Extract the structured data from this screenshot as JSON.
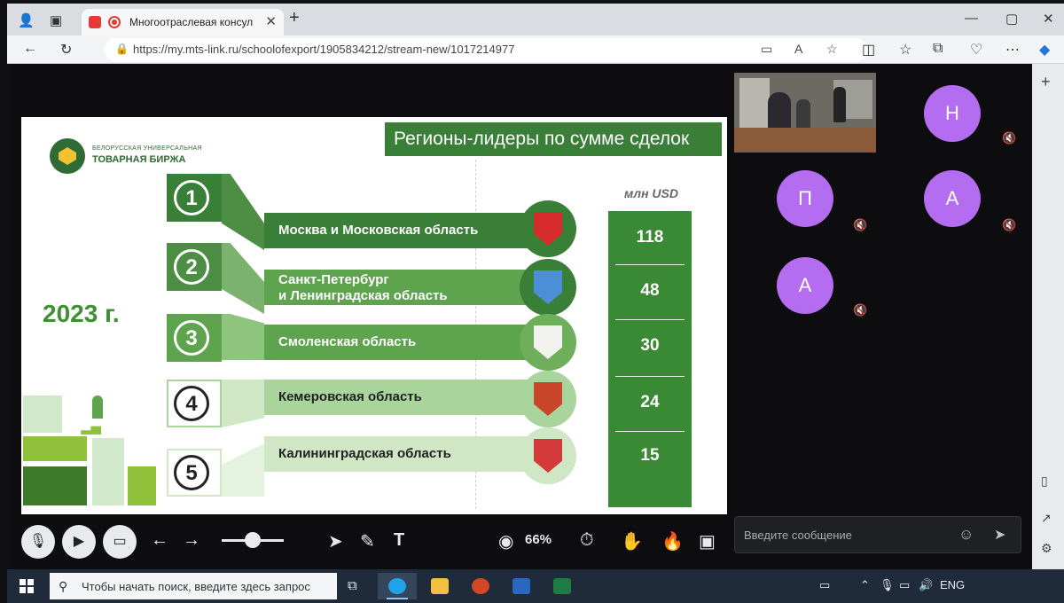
{
  "browser": {
    "tab_title": "Многоотраслевая консульт",
    "tab_close": "✕",
    "new_tab": "+",
    "url": "https://my.mts-link.ru/schoolofexport/1905834212/stream-new/1017214977",
    "window_controls": [
      "—",
      "▢",
      "✕"
    ]
  },
  "slide": {
    "title": "Регионы-лидеры по сумме сделок",
    "logo_line1": "БЕЛОРУССКАЯ УНИВЕРСАЛЬНАЯ",
    "logo_line2": "ТОВАРНАЯ БИРЖА",
    "year": "2023 г.",
    "unit": "млн USD",
    "regions": [
      {
        "rank": "1",
        "name_line1": "Москва и Московская область",
        "name_line2": "",
        "value": "118",
        "emblem": "moscow-region-coat-of-arms"
      },
      {
        "rank": "2",
        "name_line1": "Санкт-Петербург",
        "name_line2": "и Ленинградская область",
        "value": "48",
        "emblem": "leningrad-region-coat-of-arms"
      },
      {
        "rank": "3",
        "name_line1": "Смоленская область",
        "name_line2": "",
        "value": "30",
        "emblem": "smolensk-region-coat-of-arms"
      },
      {
        "rank": "4",
        "name_line1": "Кемеровская область",
        "name_line2": "",
        "value": "24",
        "emblem": "kemerovo-region-coat-of-arms"
      },
      {
        "rank": "5",
        "name_line1": "Калининградская область",
        "name_line2": "",
        "value": "15",
        "emblem": "kaliningrad-region-coat-of-arms"
      }
    ],
    "colors": {
      "dark_green": "#3a7f37",
      "mid_green": "#5ea34e",
      "light_green": "#a9d49b",
      "value_green": "#3a8a35"
    }
  },
  "toolbar": {
    "zoom": "66%"
  },
  "participants": [
    {
      "initial": "Н",
      "muted": true
    },
    {
      "initial": "П",
      "muted": true
    },
    {
      "initial": "А",
      "muted": true
    },
    {
      "initial": "А",
      "muted": true
    }
  ],
  "chat": {
    "placeholder": "Введите сообщение"
  },
  "taskbar": {
    "search_placeholder": "Чтобы начать поиск, введите здесь запрос",
    "language": "ENG"
  }
}
